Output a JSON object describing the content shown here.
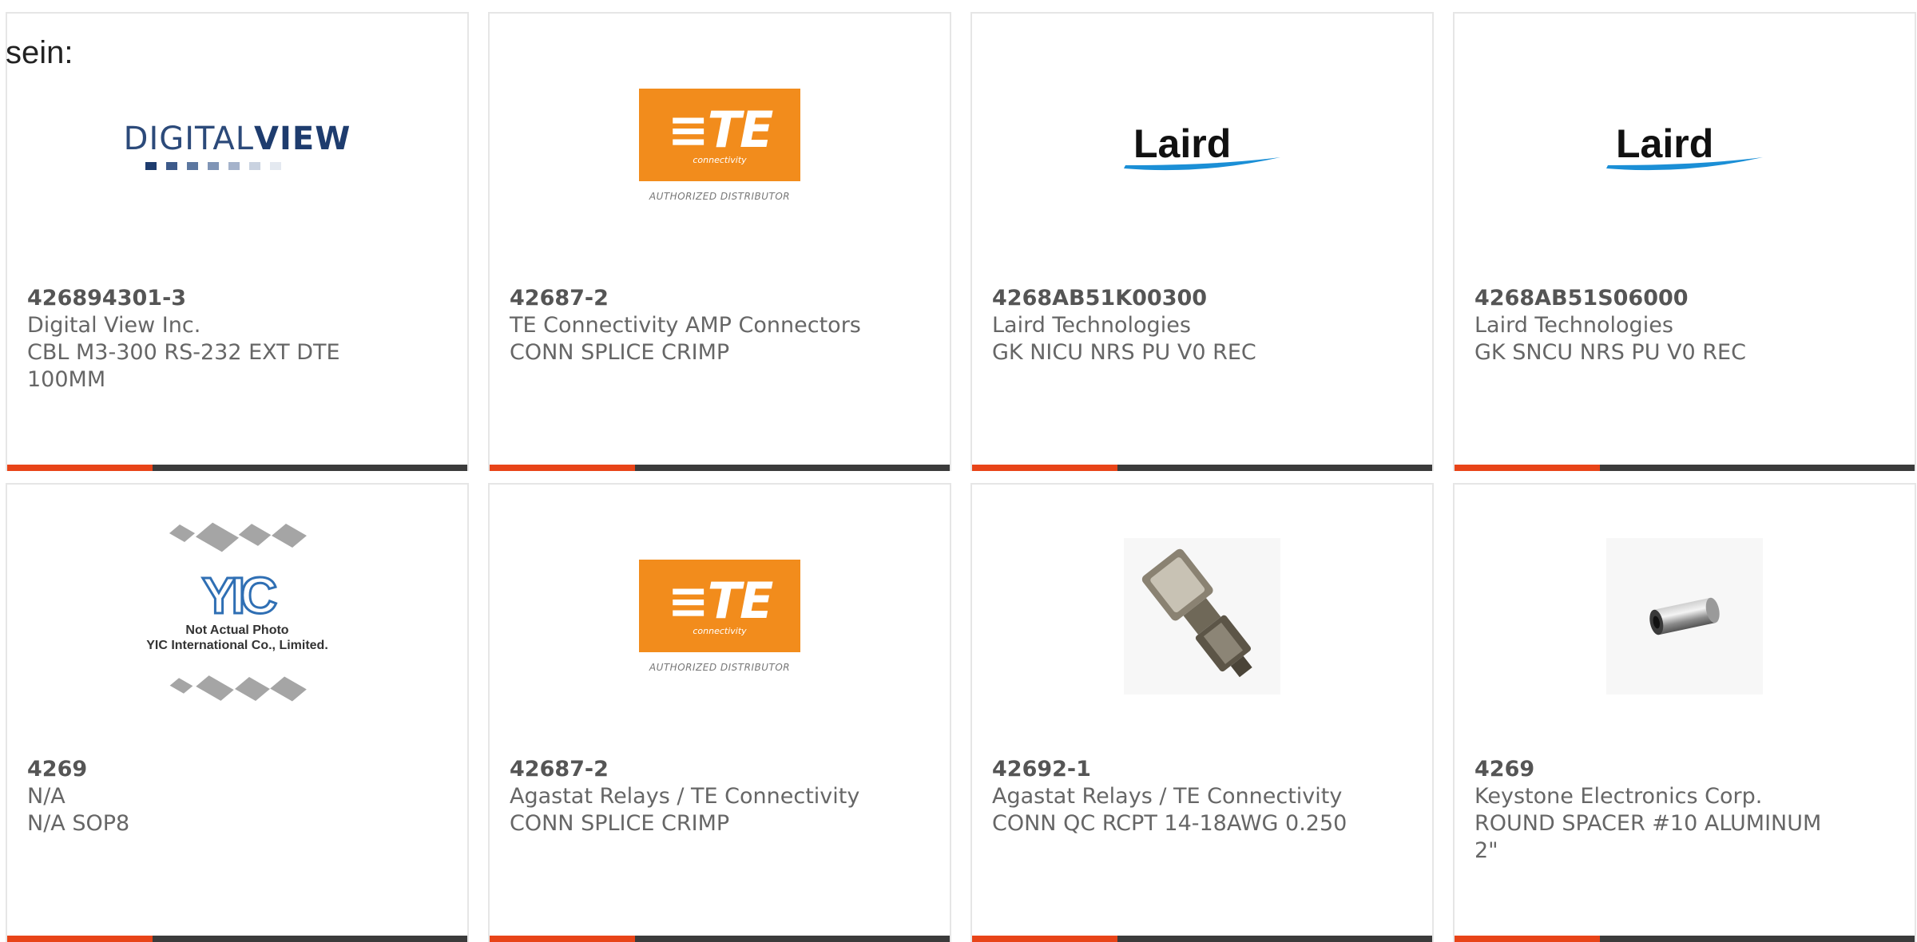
{
  "stray_text": "sein:",
  "products": [
    {
      "part_number": "426894301-3",
      "manufacturer": "Digital View Inc.",
      "description": "CBL M3-300 RS-232 EXT DTE",
      "description_line2": "100MM",
      "image": "digital-view-logo",
      "logo_text": "DIGITALVIEW",
      "logo_text_light": "DIGITAL",
      "logo_text_bold": "VIEW"
    },
    {
      "part_number": "42687-2",
      "manufacturer": "TE Connectivity AMP Connectors",
      "description": "CONN SPLICE CRIMP",
      "description_line2": "",
      "image": "te-connectivity-logo",
      "logo_mark": "≡TE",
      "logo_sub": "connectivity",
      "logo_caption": "AUTHORIZED DISTRIBUTOR"
    },
    {
      "part_number": "4268AB51K00300",
      "manufacturer": "Laird Technologies",
      "description": "GK NICU NRS PU V0 REC",
      "description_line2": "",
      "image": "laird-logo",
      "logo_text": "Laird"
    },
    {
      "part_number": "4268AB51S06000",
      "manufacturer": "Laird Technologies",
      "description": "GK SNCU NRS PU V0 REC",
      "description_line2": "",
      "image": "laird-logo",
      "logo_text": "Laird"
    },
    {
      "part_number": "4269",
      "manufacturer": "N/A",
      "description": "N/A SOP8",
      "description_line2": "",
      "image": "yic-placeholder",
      "logo_text": "YIC",
      "note_line1": "Not Actual Photo",
      "note_line2": "YIC International Co., Limited."
    },
    {
      "part_number": "42687-2",
      "manufacturer": "Agastat Relays / TE Connectivity",
      "description": "CONN SPLICE CRIMP",
      "description_line2": "",
      "image": "te-connectivity-logo",
      "logo_mark": "≡TE",
      "logo_sub": "connectivity",
      "logo_caption": "AUTHORIZED DISTRIBUTOR"
    },
    {
      "part_number": "42692-1",
      "manufacturer": "Agastat Relays / TE Connectivity",
      "description": "CONN QC RCPT 14-18AWG 0.250",
      "description_line2": "",
      "image": "quick-connect-terminal-photo"
    },
    {
      "part_number": "4269",
      "manufacturer": "Keystone Electronics Corp.",
      "description": "ROUND SPACER #10 ALUMINUM",
      "description_line2": "2\"",
      "image": "round-spacer-photo"
    }
  ],
  "colors": {
    "accent": "#e84418",
    "bar": "#3b3b3b",
    "te_orange": "#f28c1c",
    "laird_swoosh": "#1b8fd6",
    "dv_blue": "#1e3c6e"
  }
}
